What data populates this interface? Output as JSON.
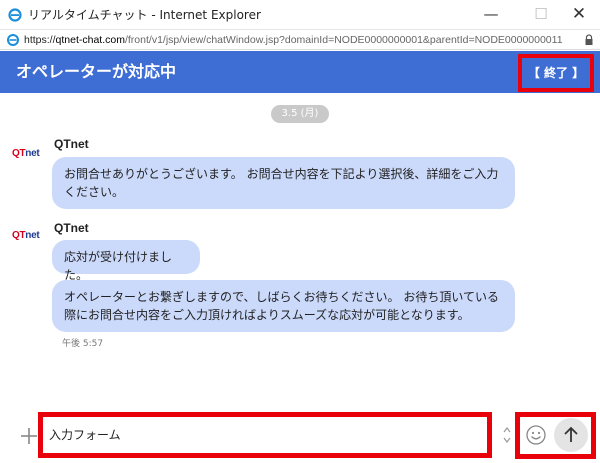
{
  "window": {
    "title": "リアルタイムチャット - Internet Explorer",
    "min_glyph": "—",
    "max_glyph": "☐",
    "close_glyph": "✕"
  },
  "address_bar": {
    "url_prefix": "https://",
    "url_host": "qtnet-chat.com",
    "url_path": "/front/v1/jsp/view/chatWindow.jsp?domainId=NODE0000000001&parentId=NODE0000000011"
  },
  "header": {
    "title": "オペレーターが対応中",
    "end_label": "【 終了 】",
    "background": "#3e6dd4"
  },
  "chat": {
    "date": "3.5 (月)",
    "logo_left": "QT",
    "logo_right": "net",
    "messages": [
      {
        "sender": "QTnet",
        "bubbles": [
          "お問合せありがとうございます。 お問合せ内容を下記より選択後、詳細をご入力ください。"
        ]
      },
      {
        "sender": "QTnet",
        "bubbles": [
          "応対が受け付けました。",
          "オペレーターとお繋ぎしますので、しばらくお待ちください。 お待ち頂いている際にお問合せ内容をご入力頂ければよりスムーズな応対が可能となります。"
        ],
        "time": "午後 5:57"
      }
    ]
  },
  "input": {
    "value": "入力フォーム"
  },
  "colors": {
    "bubble": "#cbd9fb",
    "highlight": "#e8000b"
  },
  "icons": [
    "ie-logo-icon",
    "page-icon",
    "lock-icon",
    "plus-icon",
    "spin-icon",
    "smiley-icon",
    "arrow-up-icon"
  ]
}
